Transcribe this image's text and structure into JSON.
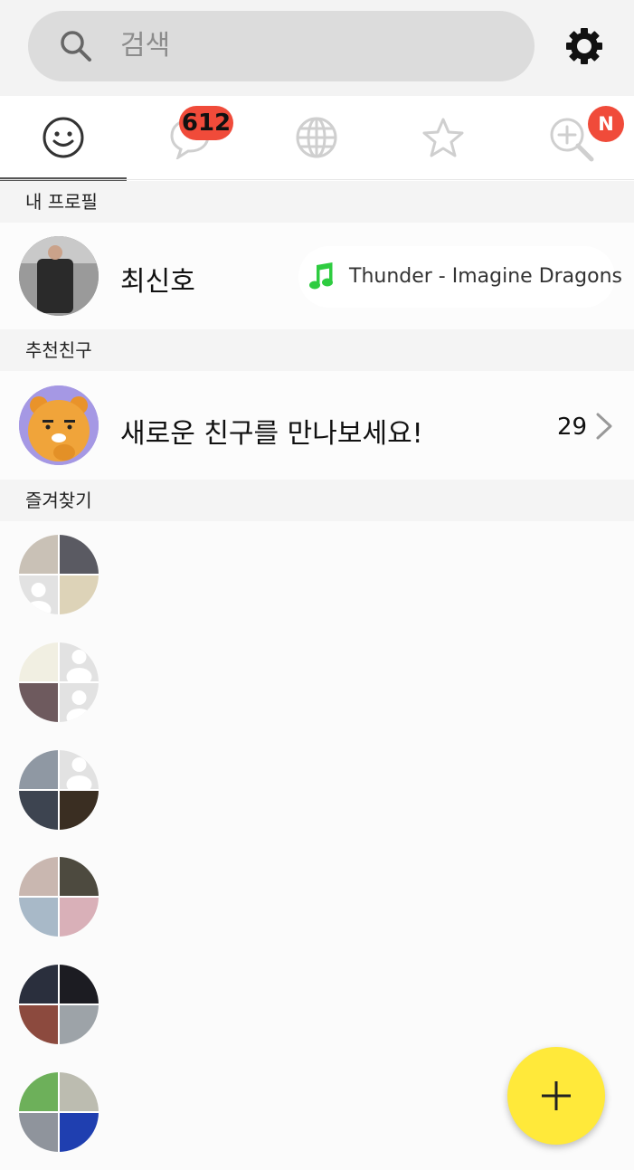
{
  "search": {
    "placeholder": "검색"
  },
  "tabs": [
    {
      "name": "friends",
      "icon": "smiley-icon",
      "active": true
    },
    {
      "name": "chats",
      "icon": "chat-bubble-icon",
      "badge": "612"
    },
    {
      "name": "discover",
      "icon": "globe-icon"
    },
    {
      "name": "favorites",
      "icon": "star-icon"
    },
    {
      "name": "search-more",
      "icon": "zoom-plus-icon",
      "badge": "N"
    }
  ],
  "sections": {
    "my_profile": "내 프로필",
    "recommended": "추천친구",
    "favorites": "즐겨찾기"
  },
  "profile": {
    "name": "최신호",
    "music": "Thunder - Imagine Dragons"
  },
  "recommend": {
    "text": "새로운 친구를 만나보세요!",
    "count": "29"
  },
  "colors": {
    "badge": "#f04b3a",
    "fab": "#ffe93a",
    "music_note": "#2ecc40"
  }
}
